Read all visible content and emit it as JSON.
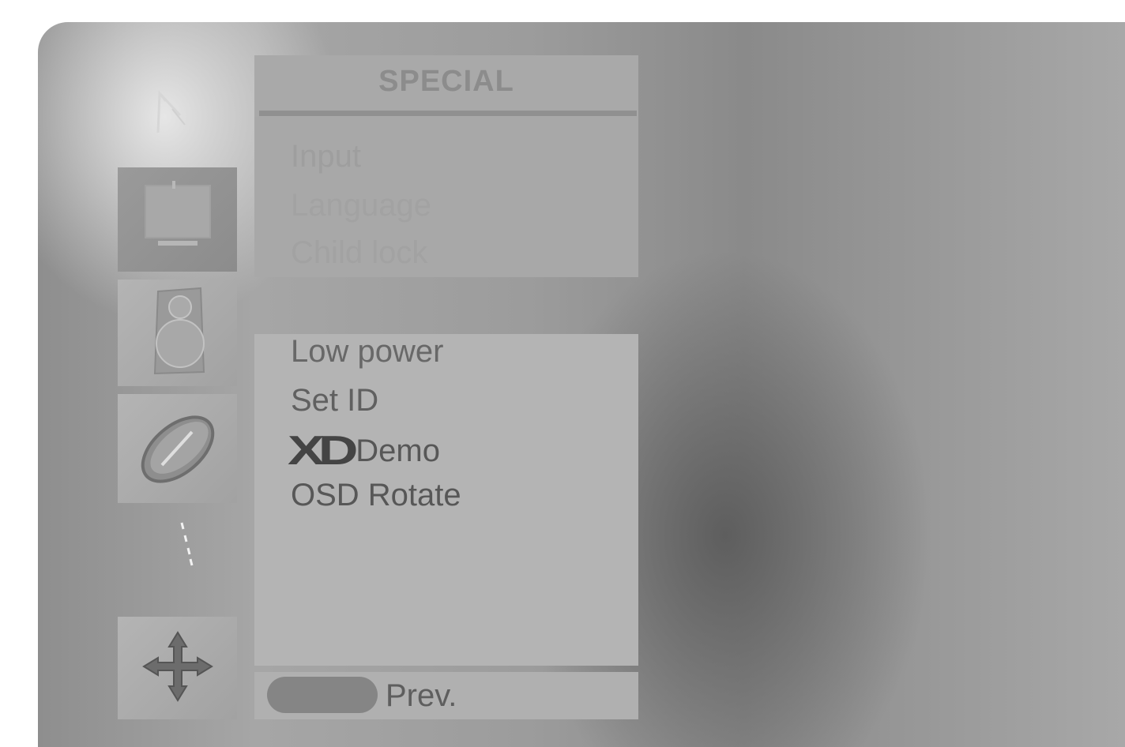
{
  "menu": {
    "title": "SPECIAL",
    "items": [
      {
        "label": "Input"
      },
      {
        "label": "Language"
      },
      {
        "label": "Child lock"
      },
      {
        "label": "Low power"
      },
      {
        "label": "Set ID"
      },
      {
        "label": "Demo",
        "logo": "XD"
      },
      {
        "label": "OSD Rotate"
      }
    ]
  },
  "footer": {
    "prev_label": "Prev."
  },
  "icons": {
    "sidebar": [
      "picture-icon",
      "sound-icon",
      "time-icon",
      "special-icon",
      "screen-icon"
    ]
  },
  "colors": {
    "menu_panel": "#b2b2b2",
    "text_active": "#575757",
    "text_dimmed": "#a2a2a2",
    "prev_button": "#858585"
  }
}
